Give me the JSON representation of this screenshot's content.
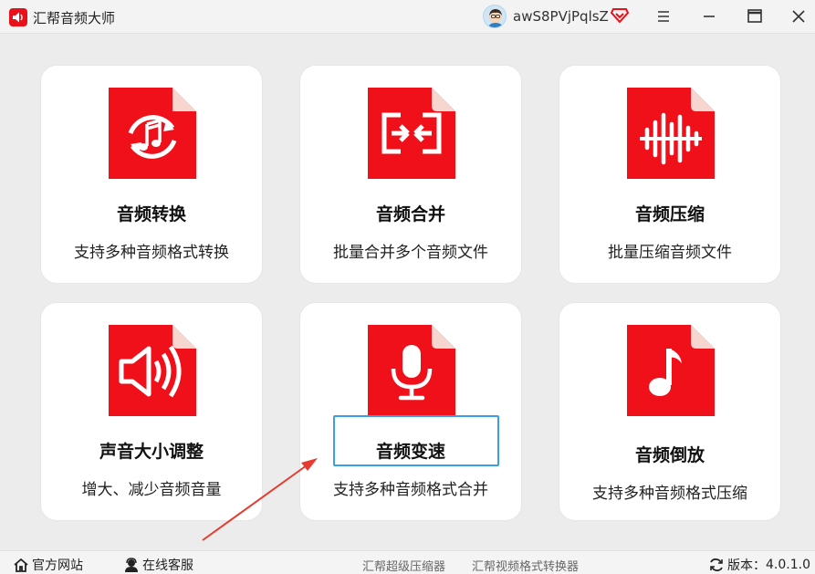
{
  "window": {
    "title": "汇帮音频大师",
    "username": "awS8PVjPqlsZ"
  },
  "colors": {
    "brand_red": "#f0101a",
    "highlight_blue": "#3a9ee8",
    "arrow_red": "#e63b2e"
  },
  "cards": [
    {
      "title": "音频转换",
      "desc": "支持多种音频格式转换",
      "icon": "audio-convert-icon"
    },
    {
      "title": "音频合并",
      "desc": "批量合并多个音频文件",
      "icon": "audio-merge-icon"
    },
    {
      "title": "音频压缩",
      "desc": "批量压缩音频文件",
      "icon": "audio-compress-icon"
    },
    {
      "title": "声音大小调整",
      "desc": "增大、减少音频音量",
      "icon": "volume-icon"
    },
    {
      "title": "音频变速",
      "desc": "支持多种音频格式合并",
      "icon": "microphone-icon"
    },
    {
      "title": "音频倒放",
      "desc": "支持多种音频格式压缩",
      "icon": "music-note-icon"
    }
  ],
  "footer": {
    "website": "官方网站",
    "support": "在线客服",
    "link1": "汇帮超级压缩器",
    "link2": "汇帮视频格式转换器",
    "version_label": "版本：",
    "version": "4.0.1.0"
  }
}
